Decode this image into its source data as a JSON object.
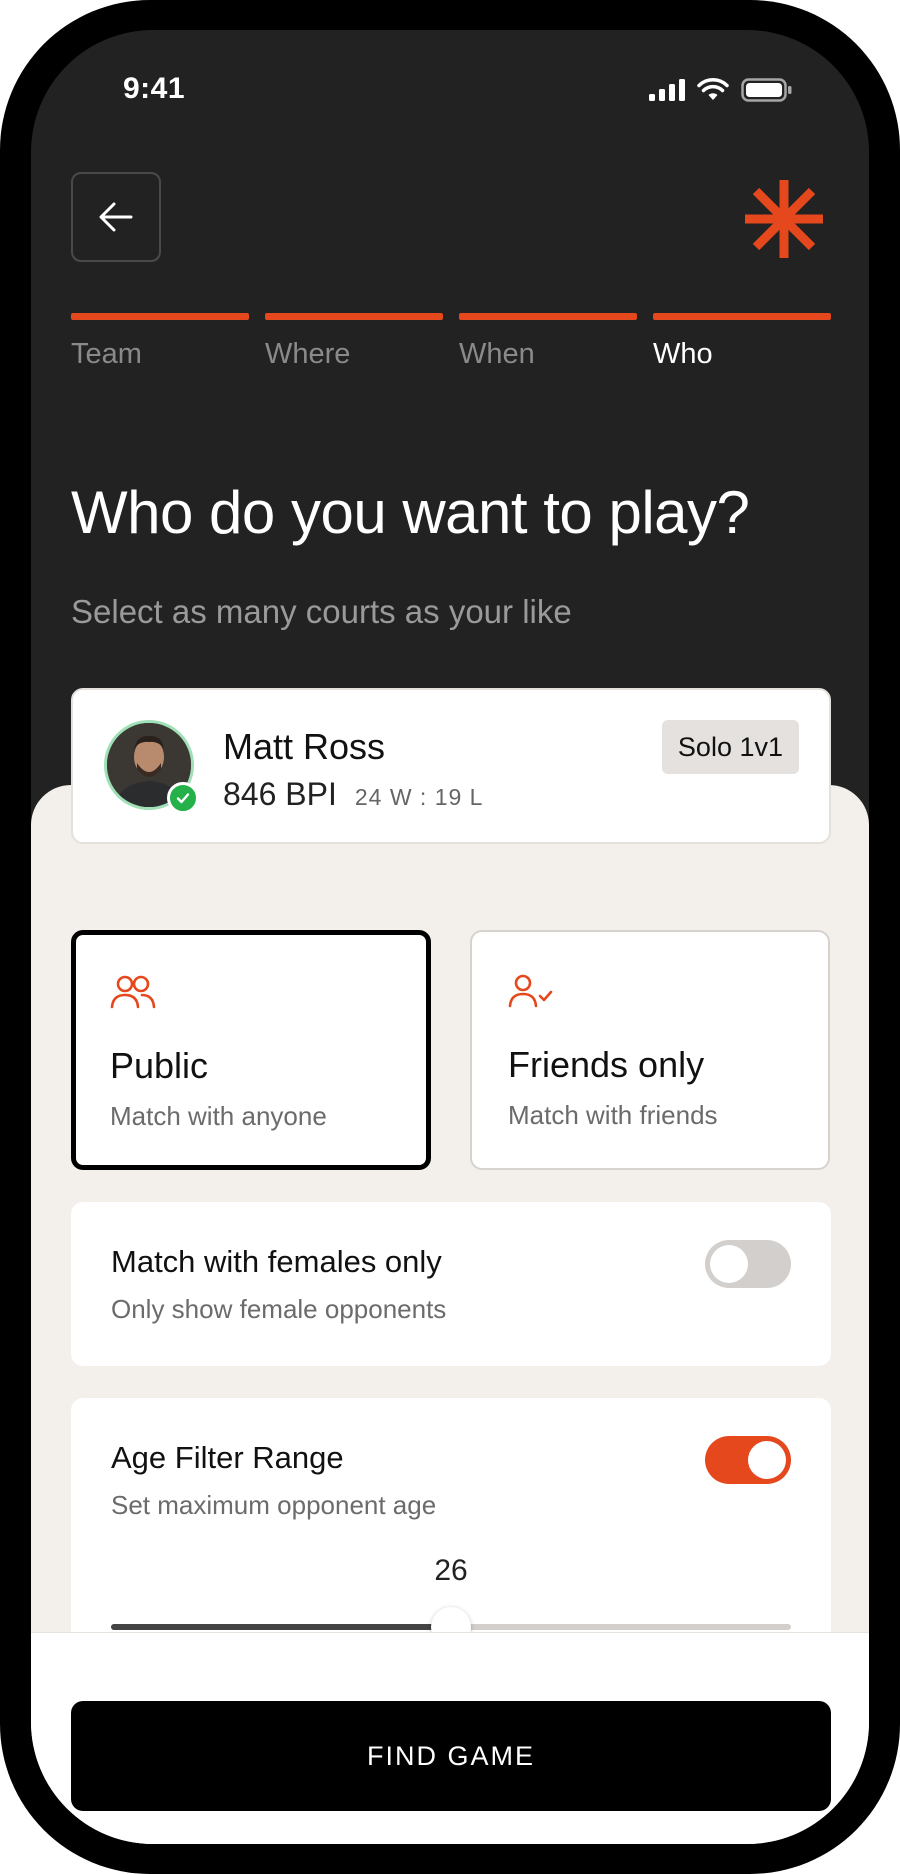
{
  "status_bar": {
    "time": "9:41"
  },
  "header": {
    "back_icon": "arrow-left-icon",
    "brand_icon": "asterisk-logo-icon"
  },
  "steps": [
    {
      "label": "Team",
      "active": false
    },
    {
      "label": "Where",
      "active": false
    },
    {
      "label": "When",
      "active": false
    },
    {
      "label": "Who",
      "active": true
    }
  ],
  "page": {
    "title": "Who do you want to play?",
    "subtitle": "Select as many courts as your like"
  },
  "profile": {
    "name": "Matt Ross",
    "bpi": "846 BPI",
    "record": "24 W : 19 L",
    "badge": "Solo 1v1"
  },
  "options": [
    {
      "title": "Public",
      "desc": "Match with anyone",
      "selected": true,
      "icon": "users-icon"
    },
    {
      "title": "Friends only",
      "desc": "Match with friends",
      "selected": false,
      "icon": "user-check-icon"
    }
  ],
  "filters": {
    "females": {
      "title": "Match with females only",
      "desc": "Only show female opponents",
      "enabled": false
    },
    "age": {
      "title": "Age Filter Range",
      "desc": "Set maximum opponent age",
      "enabled": true,
      "value": "26",
      "slider_fraction": 0.5
    }
  },
  "cta": {
    "label": "FIND GAME"
  },
  "colors": {
    "accent": "#e5481d",
    "dark_bg": "#222222",
    "panel_bg": "#f3efea",
    "verified": "#24b14a"
  }
}
